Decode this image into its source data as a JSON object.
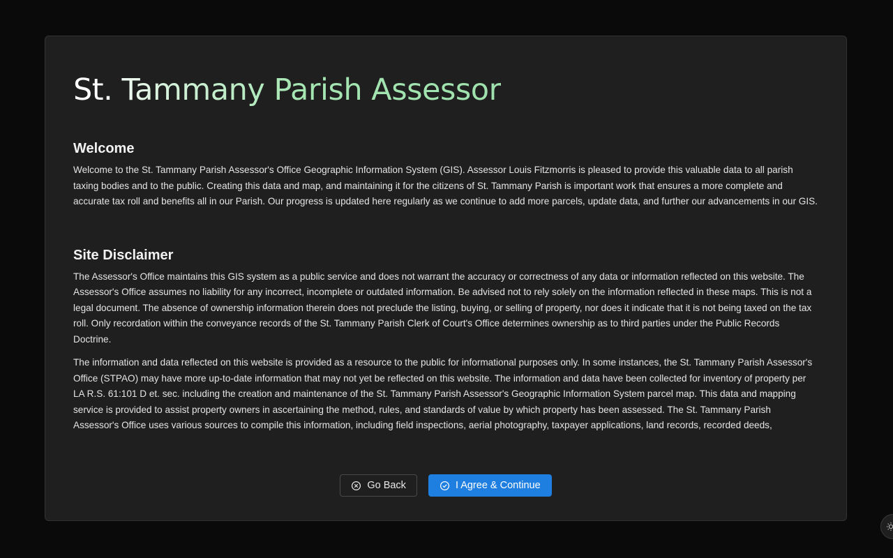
{
  "dialog": {
    "title": "St. Tammany Parish Assessor",
    "sections": [
      {
        "heading": "Welcome",
        "paragraphs": [
          "Welcome to the St. Tammany Parish Assessor's Office Geographic Information System (GIS). Assessor Louis Fitzmorris is pleased to provide this valuable data to all parish taxing bodies and to the public. Creating this data and map, and maintaining it for the citizens of St. Tammany Parish is important work that ensures a more complete and accurate tax roll and benefits all in our Parish. Our progress is updated here regularly as we continue to add more parcels, update data, and further our advancements in our GIS."
        ]
      },
      {
        "heading": "Site Disclaimer",
        "paragraphs": [
          "The Assessor's Office maintains this GIS system as a public service and does not warrant the accuracy or correctness of any data or information reflected on this website. The Assessor's Office assumes no liability for any incorrect, incomplete or outdated information. Be advised not to rely solely on the information reflected in these maps. This is not a legal document. The absence of ownership information therein does not preclude the listing, buying, or selling of property, nor does it indicate that it is not being taxed on the tax roll. Only recordation within the conveyance records of the St. Tammany Parish Clerk of Court's Office determines ownership as to third parties under the Public Records Doctrine.",
          "The information and data reflected on this website is provided as a resource to the public for informational purposes only. In some instances, the St. Tammany Parish Assessor's Office (STPAO) may have more up-to-date information that may not yet be reflected on this website. The information and data have been collected for inventory of property per LA R.S. 61:101 D et. sec. including the creation and maintenance of the St. Tammany Parish Assessor's Geographic Information System parcel map. This data and mapping service is provided to assist property owners in ascertaining the method, rules, and standards of value by which property has been assessed. The St. Tammany Parish Assessor's Office uses various sources to compile this information, including field inspections, aerial photography, taxpayer applications, land records, recorded deeds,"
        ]
      }
    ],
    "buttons": {
      "go_back": {
        "label": "Go Back",
        "icon": "close-circle-icon"
      },
      "agree": {
        "label": "I Agree & Continue",
        "icon": "check-circle-icon"
      }
    }
  },
  "theme_toggle": {
    "icon": "sun-icon"
  },
  "colors": {
    "page_bg": "#0a0a0a",
    "dialog_bg": "#1f1f1f",
    "primary": "#1f7fe0",
    "title_accent": "#a5e6b3"
  }
}
